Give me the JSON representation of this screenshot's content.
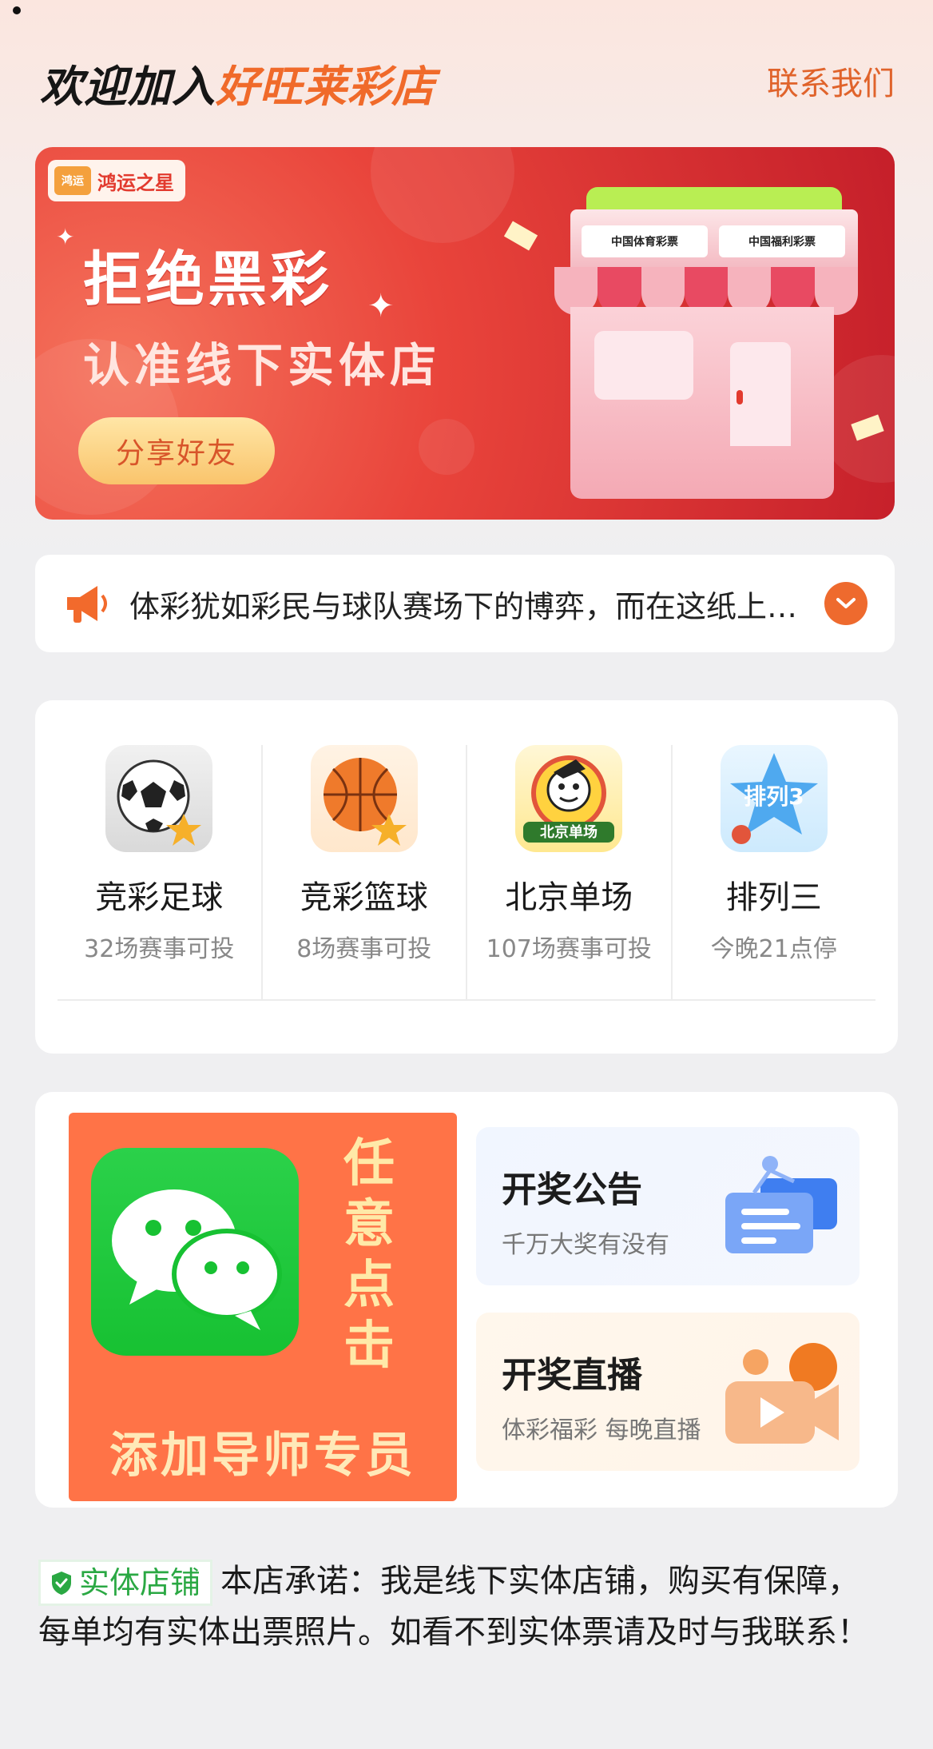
{
  "header": {
    "welcome_prefix": "欢迎加入",
    "store_name": "好旺莱彩店",
    "contact_label": "联系我们"
  },
  "banner": {
    "brand_badge": "鸿运",
    "brand_name": "鸿运之星",
    "title": "拒绝黑彩",
    "subtitle": "认准线下实体店",
    "share_button": "分享好友",
    "sign_left": "中国体育彩票",
    "sign_right": "中国福利彩票"
  },
  "notice": {
    "text": "体彩犹如彩民与球队赛场下的博弈，而在这纸上…"
  },
  "games": [
    {
      "name": "竞彩足球",
      "sub": "32场赛事可投",
      "icon": "soccer-ball-icon"
    },
    {
      "name": "竞彩篮球",
      "sub": "8场赛事可投",
      "icon": "basketball-icon"
    },
    {
      "name": "北京单场",
      "sub": "107场赛事可投",
      "icon": "beijing-single-icon"
    },
    {
      "name": "排列三",
      "sub": "今晚21点停",
      "icon": "pailie3-icon"
    }
  ],
  "game_icon_texts": {
    "beijing_single": "北京单场",
    "pailie3": "排列3"
  },
  "services": {
    "wechat_side_text": [
      "任",
      "意",
      "点",
      "击"
    ],
    "wechat_bottom": "添加导师专员",
    "draw_notice_title": "开奖公告",
    "draw_notice_sub": "千万大奖有没有",
    "draw_live_title": "开奖直播",
    "draw_live_sub": "体彩福彩 每晚直播"
  },
  "promise": {
    "badge": "实体店铺",
    "text": "本店承诺：我是线下实体店铺，购买有保障， 每单均有实体出票照片。如看不到实体票请及时与我联系！"
  },
  "colors": {
    "accent": "#f06a2a",
    "banner_red": "#e23a2e",
    "wechat_green": "#17c132",
    "badge_green": "#2aa843"
  }
}
